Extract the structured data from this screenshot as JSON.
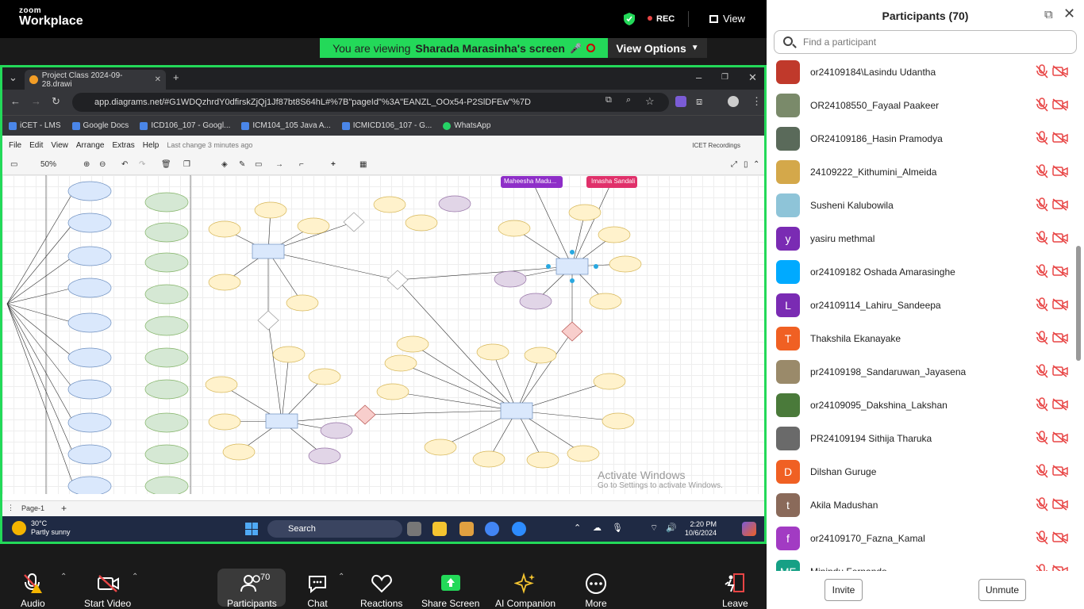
{
  "zoom": {
    "logo_top": "zoom",
    "logo_bottom": "Workplace",
    "rec_label": "REC",
    "view_label": "View",
    "viewing_prefix": "You are viewing",
    "viewing_name": "Sharada Marasinha's screen",
    "view_options_label": "View Options"
  },
  "browser": {
    "tab_title": "Project Class 2024-09-28.drawi",
    "url": "app.diagrams.net/#G1WDQzhrdY0dfirskZjQj1Jf87bt8S64hL#%7B\"pageId\"%3A\"EANZL_OOx54-P2SlDFEw\"%7D",
    "bookmarks": [
      "iCET - LMS",
      "Google Docs",
      "ICD106_107 - Googl...",
      "ICM104_105 Java A...",
      "ICMICD106_107 - G...",
      "WhatsApp"
    ]
  },
  "drawio": {
    "menu": [
      "File",
      "Edit",
      "View",
      "Arrange",
      "Extras",
      "Help"
    ],
    "last_change": "Last change 3 minutes ago",
    "recordings": "ICET Recordings",
    "zoom_level": "50%",
    "page_tab": "Page-1",
    "collab_1": "Maheesha Madu...",
    "collab_2": "Imasha Sandali",
    "activate_title": "Activate Windows",
    "activate_sub": "Go to Settings to activate Windows."
  },
  "taskbar": {
    "temp": "30°C",
    "weather": "Partly sunny",
    "search": "Search",
    "time": "2:20 PM",
    "date": "10/6/2024"
  },
  "panel": {
    "title": "Participants (70)",
    "search_placeholder": "Find a participant",
    "invite_label": "Invite",
    "unmute_label": "Unmute",
    "participants": [
      {
        "name": "or24109184\\Lasindu Udantha",
        "initial": "",
        "color": "#c0392b"
      },
      {
        "name": "OR24108550_Fayaal Paakeer",
        "initial": "",
        "color": "#7a8a6a"
      },
      {
        "name": "OR24109186_Hasin Pramodya",
        "initial": "",
        "color": "#5a6a5a"
      },
      {
        "name": "24109222_Kithumini_Almeida",
        "initial": "",
        "color": "#d4a84a"
      },
      {
        "name": "Susheni Kalubowila",
        "initial": "",
        "color": "#8ec4d8"
      },
      {
        "name": "yasiru methmal",
        "initial": "y",
        "color": "#7a2bb3"
      },
      {
        "name": "or24109182 Oshada Amarasinghe",
        "initial": "",
        "color": "#00aaff"
      },
      {
        "name": "or24109114_Lahiru_Sandeepa",
        "initial": "L",
        "color": "#7a2bb3"
      },
      {
        "name": "Thakshila Ekanayake",
        "initial": "T",
        "color": "#f06023"
      },
      {
        "name": "pr24109198_Sandaruwan_Jayasena",
        "initial": "",
        "color": "#9a8a6a"
      },
      {
        "name": "or24109095_Dakshina_Lakshan",
        "initial": "",
        "color": "#4a7a3a"
      },
      {
        "name": "PR24109194 Sithija Tharuka",
        "initial": "",
        "color": "#6a6a6a"
      },
      {
        "name": "Dilshan Guruge",
        "initial": "D",
        "color": "#f06023"
      },
      {
        "name": "Akila Madushan",
        "initial": "t",
        "color": "#8a6a5a"
      },
      {
        "name": "or24109170_Fazna_Kamal",
        "initial": "f",
        "color": "#a23bc3"
      },
      {
        "name": "Minindu Fernando",
        "initial": "MF",
        "color": "#16a085"
      }
    ]
  },
  "bottombar": {
    "audio": "Audio",
    "video": "Start Video",
    "participants": "Participants",
    "participants_count": "70",
    "chat": "Chat",
    "reactions": "Reactions",
    "share": "Share Screen",
    "ai": "AI Companion",
    "more": "More",
    "leave": "Leave"
  }
}
